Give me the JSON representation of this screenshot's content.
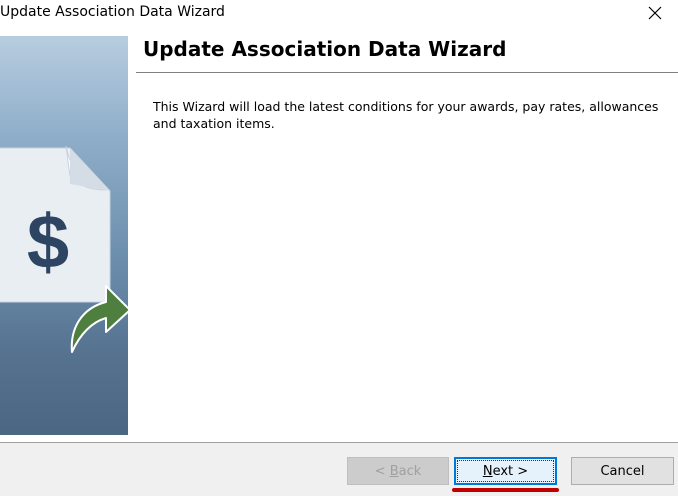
{
  "window": {
    "title": "Update Association Data Wizard",
    "close_icon": "close-icon"
  },
  "banner": {
    "icon": "document-dollar-icon",
    "symbol": "$",
    "arrow_icon": "curved-arrow-icon"
  },
  "header": {
    "title": "Update Association Data Wizard"
  },
  "body": {
    "description": "This Wizard will load the latest conditions for your awards, pay rates, allowances and taxation items."
  },
  "buttons": {
    "back_prefix": "< ",
    "back_mnemonic": "B",
    "back_rest": "ack",
    "back_enabled": false,
    "next_mnemonic": "N",
    "next_rest": "ext >",
    "cancel_label": "Cancel"
  },
  "colors": {
    "banner_top": "#b8cde0",
    "banner_bottom": "#4b6682",
    "arrow_fill": "#4e7f3f",
    "focus_border": "#0078d7",
    "highlight_mark": "#c00000"
  }
}
